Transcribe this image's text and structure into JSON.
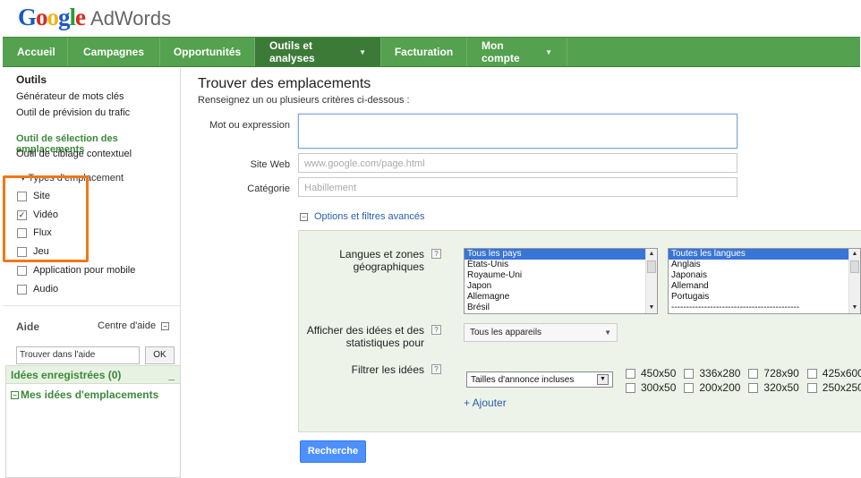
{
  "logo": {
    "google": "Google",
    "product": "AdWords"
  },
  "nav": {
    "items": [
      {
        "label": "Accueil",
        "caret": false
      },
      {
        "label": "Campagnes",
        "caret": false
      },
      {
        "label": "Opportunités",
        "caret": false
      },
      {
        "label": "Outils et analyses",
        "caret": true,
        "active": true
      },
      {
        "label": "Facturation",
        "caret": false
      },
      {
        "label": "Mon compte",
        "caret": true
      }
    ],
    "caret_glyph": "▼"
  },
  "sidebar": {
    "title": "Outils",
    "links": [
      "Générateur de mots clés",
      "Outil de prévision du trafic"
    ],
    "active_tool": "Outil de sélection des emplacements",
    "context_tool": "Outil de ciblage contextuel",
    "types_label": "Types d'emplacement",
    "types_arrow": "▾",
    "types": [
      {
        "label": "Site",
        "checked": false
      },
      {
        "label": "Vidéo",
        "checked": true
      },
      {
        "label": "Flux",
        "checked": false
      },
      {
        "label": "Jeu",
        "checked": false
      },
      {
        "label": "Application pour mobile",
        "checked": false
      },
      {
        "label": "Audio",
        "checked": false
      }
    ],
    "check_glyph": "✓",
    "help": {
      "title": "Aide",
      "center": "Centre d'aide",
      "minus": "−",
      "search_value": "Trouver dans l'aide",
      "ok": "OK"
    },
    "ideas": {
      "header": "Idées enregistrées (0)",
      "collapse": "_",
      "link": "Mes idées d'emplacements",
      "minus": "−"
    }
  },
  "main": {
    "title": "Trouver des emplacements",
    "subtitle": "Renseignez un ou plusieurs critères ci-dessous :",
    "fields": {
      "keyword_label": "Mot ou expression",
      "keyword_value": "",
      "site_label": "Site Web",
      "site_placeholder": "www.google.com/page.html",
      "category_label": "Catégorie",
      "category_placeholder": "Habillement"
    },
    "options_link": "Options et filtres avancés",
    "options_minus": "−",
    "panel": {
      "lang_label_1": "Langues et zones",
      "lang_label_2": "géographiques",
      "qmark": "?",
      "countries": [
        "Tous les pays",
        "États-Unis",
        "Royaume-Uni",
        "Japon",
        "Allemagne",
        "Brésil"
      ],
      "languages": [
        "Toutes les langues",
        "Anglais",
        "Japonais",
        "Allemand",
        "Portugais",
        "-------------------------------------------"
      ],
      "scroll_up": "▲",
      "scroll_down": "▼",
      "devices_label_1": "Afficher des idées et des",
      "devices_label_2": "statistiques pour",
      "devices_value": "Tous les appareils",
      "filter_label": "Filtrer les idées",
      "filter_value": "Tailles d'annonce incluses",
      "sizes_row1": [
        "450x50",
        "336x280",
        "728x90",
        "425x600"
      ],
      "sizes_row2": [
        "300x50",
        "200x200",
        "320x50",
        "250x250"
      ],
      "add_link": "+ Ajouter"
    },
    "search_button": "Recherche"
  },
  "colors": {
    "nav_green": "#54a14f",
    "nav_active": "#3c7a38",
    "link_green": "#3a8a3a",
    "link_blue": "#2a5db0",
    "highlight_orange": "#f07818",
    "button_blue": "#4d90fe"
  }
}
